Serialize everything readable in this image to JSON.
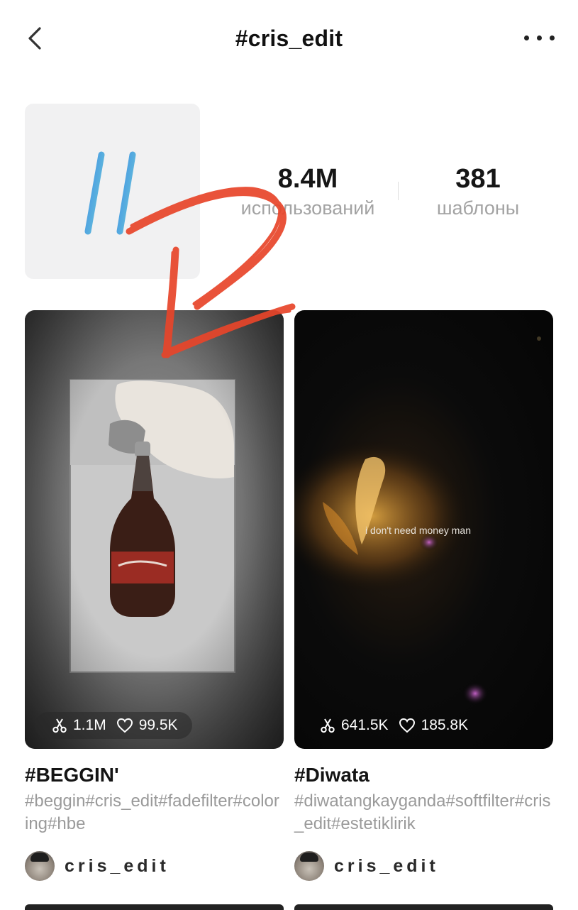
{
  "header": {
    "title": "#cris_edit",
    "back_icon": "chevron-left-icon",
    "more_icon": "more-horizontal-icon"
  },
  "hashtag": {
    "icon": "hashtag-icon",
    "uses_count": "8.4M",
    "uses_label": "использований",
    "templates_count": "381",
    "templates_label": "шаблоны"
  },
  "cards": [
    {
      "uses": "1.1M",
      "likes": "99.5K",
      "title": "#BEGGIN'",
      "tags": "#beggin#cris_edit#fadefilter#coloring#hbe",
      "author": "cris_edit"
    },
    {
      "uses": "641.5K",
      "likes": "185.8K",
      "title": "#Diwata",
      "tags": "#diwatangkayganda#softfilter#cris_edit#estetiklirik",
      "author": "cris_edit",
      "overlay_text": "i don't need money man"
    }
  ],
  "colors": {
    "accent_hashtag": "#4da3e8",
    "annotation": "#e8452a",
    "muted_text": "#a3a3a3"
  }
}
